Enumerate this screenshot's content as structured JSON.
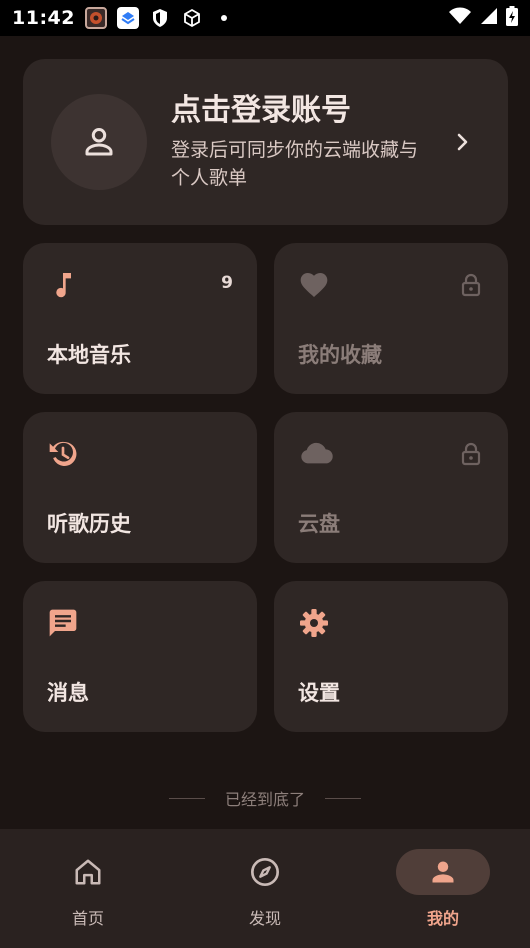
{
  "status_bar": {
    "time": "11:42",
    "notification_icons": [
      "app-icon-red",
      "app-icon-layers",
      "shield-icon",
      "cube-icon",
      "dot-icon"
    ],
    "right_icons": [
      "wifi-icon",
      "signal-icon",
      "battery-charging-icon"
    ]
  },
  "login_card": {
    "title": "点击登录账号",
    "subtitle": "登录后可同步你的云端收藏与个人歌单"
  },
  "tiles": [
    {
      "label": "本地音乐",
      "icon": "music-note-icon",
      "badge": "9",
      "locked": false
    },
    {
      "label": "我的收藏",
      "icon": "heart-icon",
      "badge": "",
      "locked": true
    },
    {
      "label": "听歌历史",
      "icon": "history-icon",
      "badge": "",
      "locked": false
    },
    {
      "label": "云盘",
      "icon": "cloud-icon",
      "badge": "",
      "locked": true
    },
    {
      "label": "消息",
      "icon": "message-icon",
      "badge": "",
      "locked": false
    },
    {
      "label": "设置",
      "icon": "settings-gear-icon",
      "badge": "",
      "locked": false
    }
  ],
  "footer_note": "已经到底了",
  "nav": {
    "items": [
      {
        "label": "首页",
        "icon": "home-icon",
        "active": false
      },
      {
        "label": "发现",
        "icon": "compass-icon",
        "active": false
      },
      {
        "label": "我的",
        "icon": "person-icon",
        "active": true
      }
    ]
  },
  "colors": {
    "background": "#1c1513",
    "card": "#2f2725",
    "accent": "#f0a58c",
    "muted": "#6e6260"
  }
}
